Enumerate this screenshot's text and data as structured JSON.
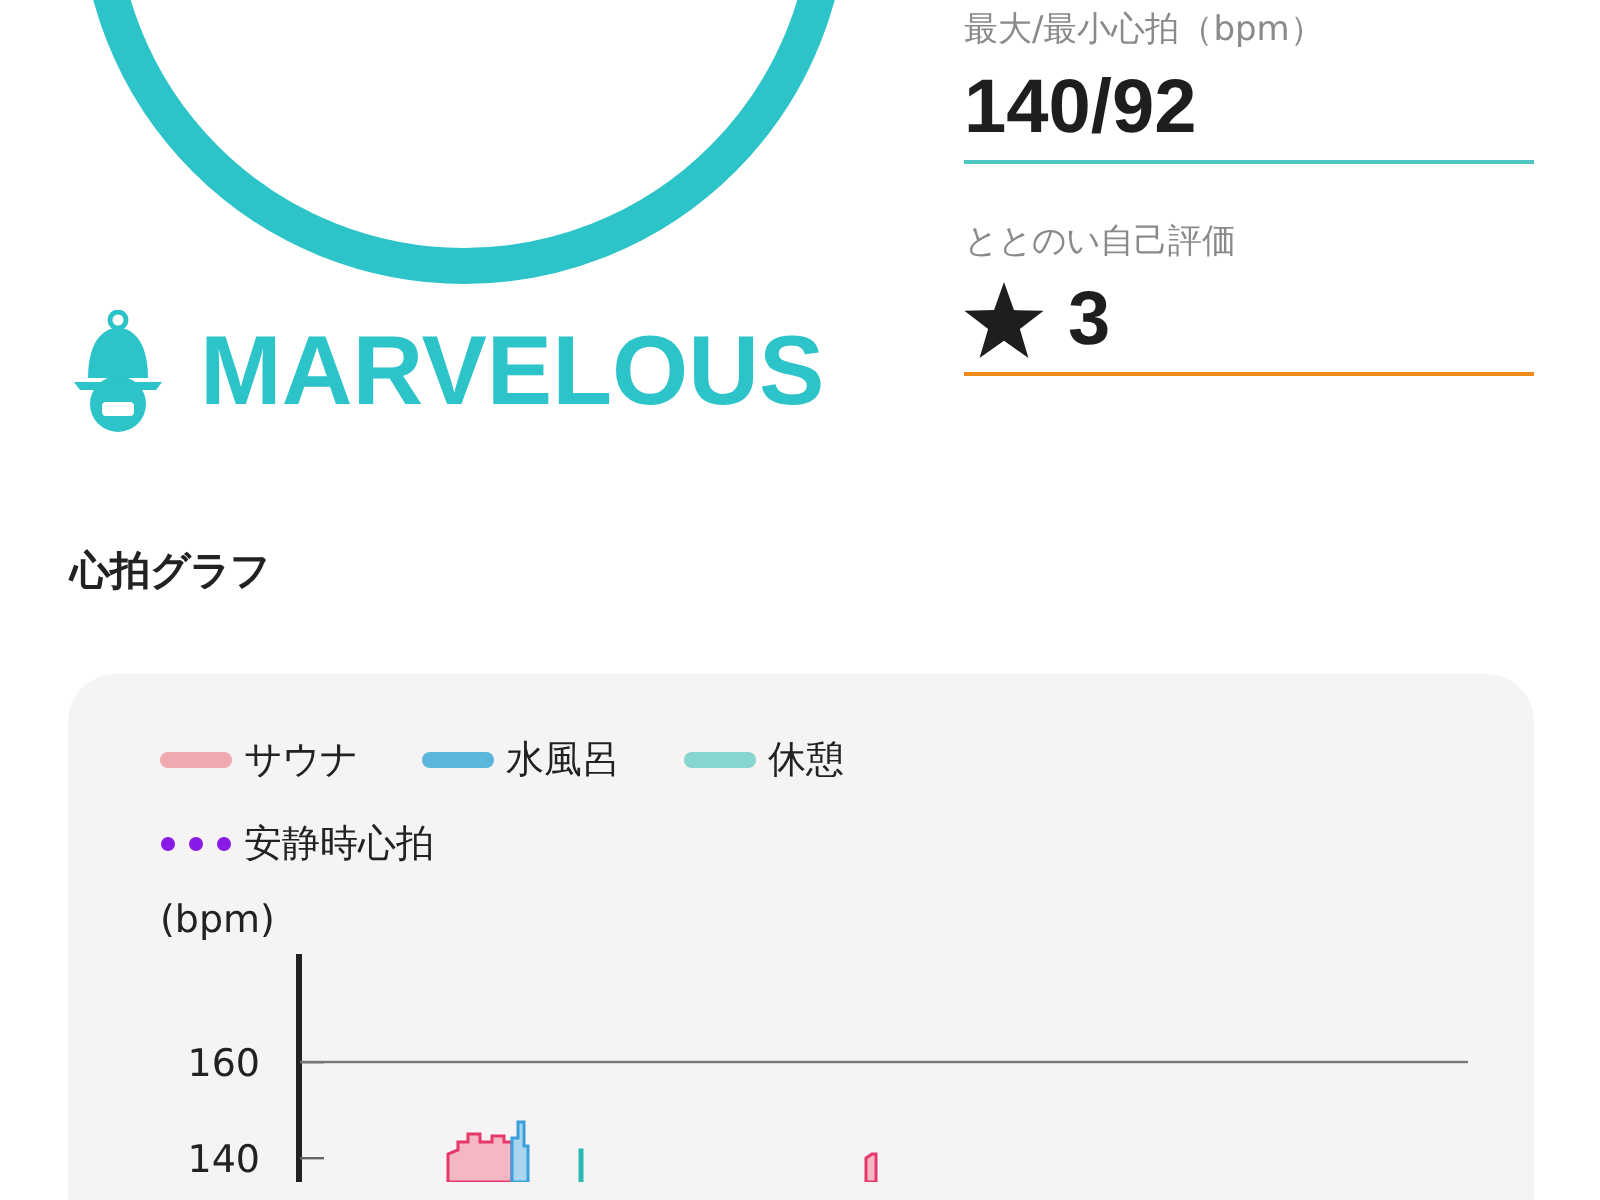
{
  "result": {
    "rank": "MARVELOUS"
  },
  "stats": [
    {
      "label": "最大/最小心拍（bpm）",
      "value": "140/92",
      "kind": "text",
      "color": "#4fc4c0"
    },
    {
      "label": "ととのい自己評価",
      "value": "3",
      "kind": "star",
      "color": "#f08a1c"
    }
  ],
  "graph": {
    "title": "心拍グラフ",
    "legend": [
      {
        "label": "サウナ",
        "color": "#eeaaae",
        "kind": "solid"
      },
      {
        "label": "水風呂",
        "color": "#5bb8dc",
        "kind": "solid"
      },
      {
        "label": "休憩",
        "color": "#86d6d0",
        "kind": "solid"
      },
      {
        "label": "安静時心拍",
        "color": "#8a1ae8",
        "kind": "dotted"
      }
    ],
    "unit": "(bpm)",
    "y_ticks": [
      "160",
      "140"
    ]
  }
}
